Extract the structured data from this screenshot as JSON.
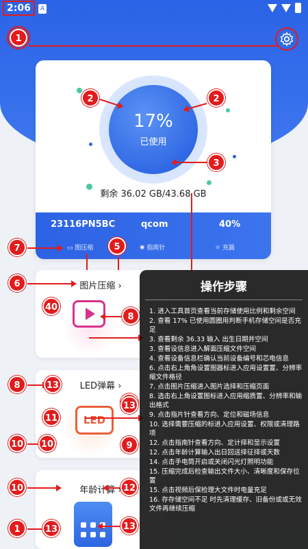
{
  "status_bar": {
    "time": "2:06",
    "notif": "A"
  },
  "storage": {
    "percent": "17%",
    "used_label": "已使用",
    "remaining": "剩余 36.02 GB/43.68 GB"
  },
  "device": {
    "model": "23116PN5BC",
    "platform": "qcom",
    "battery": "40%"
  },
  "tools": {
    "image_compress": "图压缩",
    "compass": "指南针",
    "charge": "充篇"
  },
  "features": [
    {
      "title": "图片压缩 ›"
    },
    {
      "title": "LED弹幕 ›"
    },
    {
      "title": "年龄计算 ›"
    }
  ],
  "led_text": "LED",
  "steps": {
    "title": "操作步骤",
    "items": [
      "1. 进入工具首页查看当前存储使用比例和剩余空间",
      "2. 查看 17% 已使用圆圈用判断手机存储空间是否充足",
      "3. 查看剩余 36.33  输入 出生日期并空间",
      "3. 查看设信息进入解面压缩文件空间",
      "4. 查看设备信息栏确认当前设备编号和芯电信息",
      "6. 点击右上角角设置图器标进入应用设置置、分辨率缩文件格径",
      "7. 点击图片压缩进入图片选择和压缩页面",
      "8. 选击右上角设置图标进入应用缩质置、分辨率和输出格式",
      "9. 点击指片针查看方向、定位和磁场信息",
      "10. 选择需要压缩的标进入应用设置、权限或清理路项",
      "12. 点击指南针查看方向、定计择和显示设置",
      "12. 点击年龄计算输入出日回送择征择或天数",
      "14. 点击手电筒开启或关闭闪光灯照明功能",
      "15. 压缩完成后检查输出文件大小、清晰度和保存位置",
      "15. 点击视频后保检理大文件时电量充足",
      "16. 存存储空间不足 时先清理缓存、旧备份或或无效文件再继续压缩"
    ]
  },
  "badges": [
    "1",
    "2",
    "2",
    "3",
    "7",
    "5",
    "6",
    "40",
    "8",
    "8",
    "13",
    "9",
    "11",
    "9",
    "10",
    "10",
    "12",
    "12",
    "13",
    "13"
  ],
  "colors": {
    "primary": "#2b63e6",
    "annotation": "#e31b1b",
    "overlay": "#141414"
  }
}
